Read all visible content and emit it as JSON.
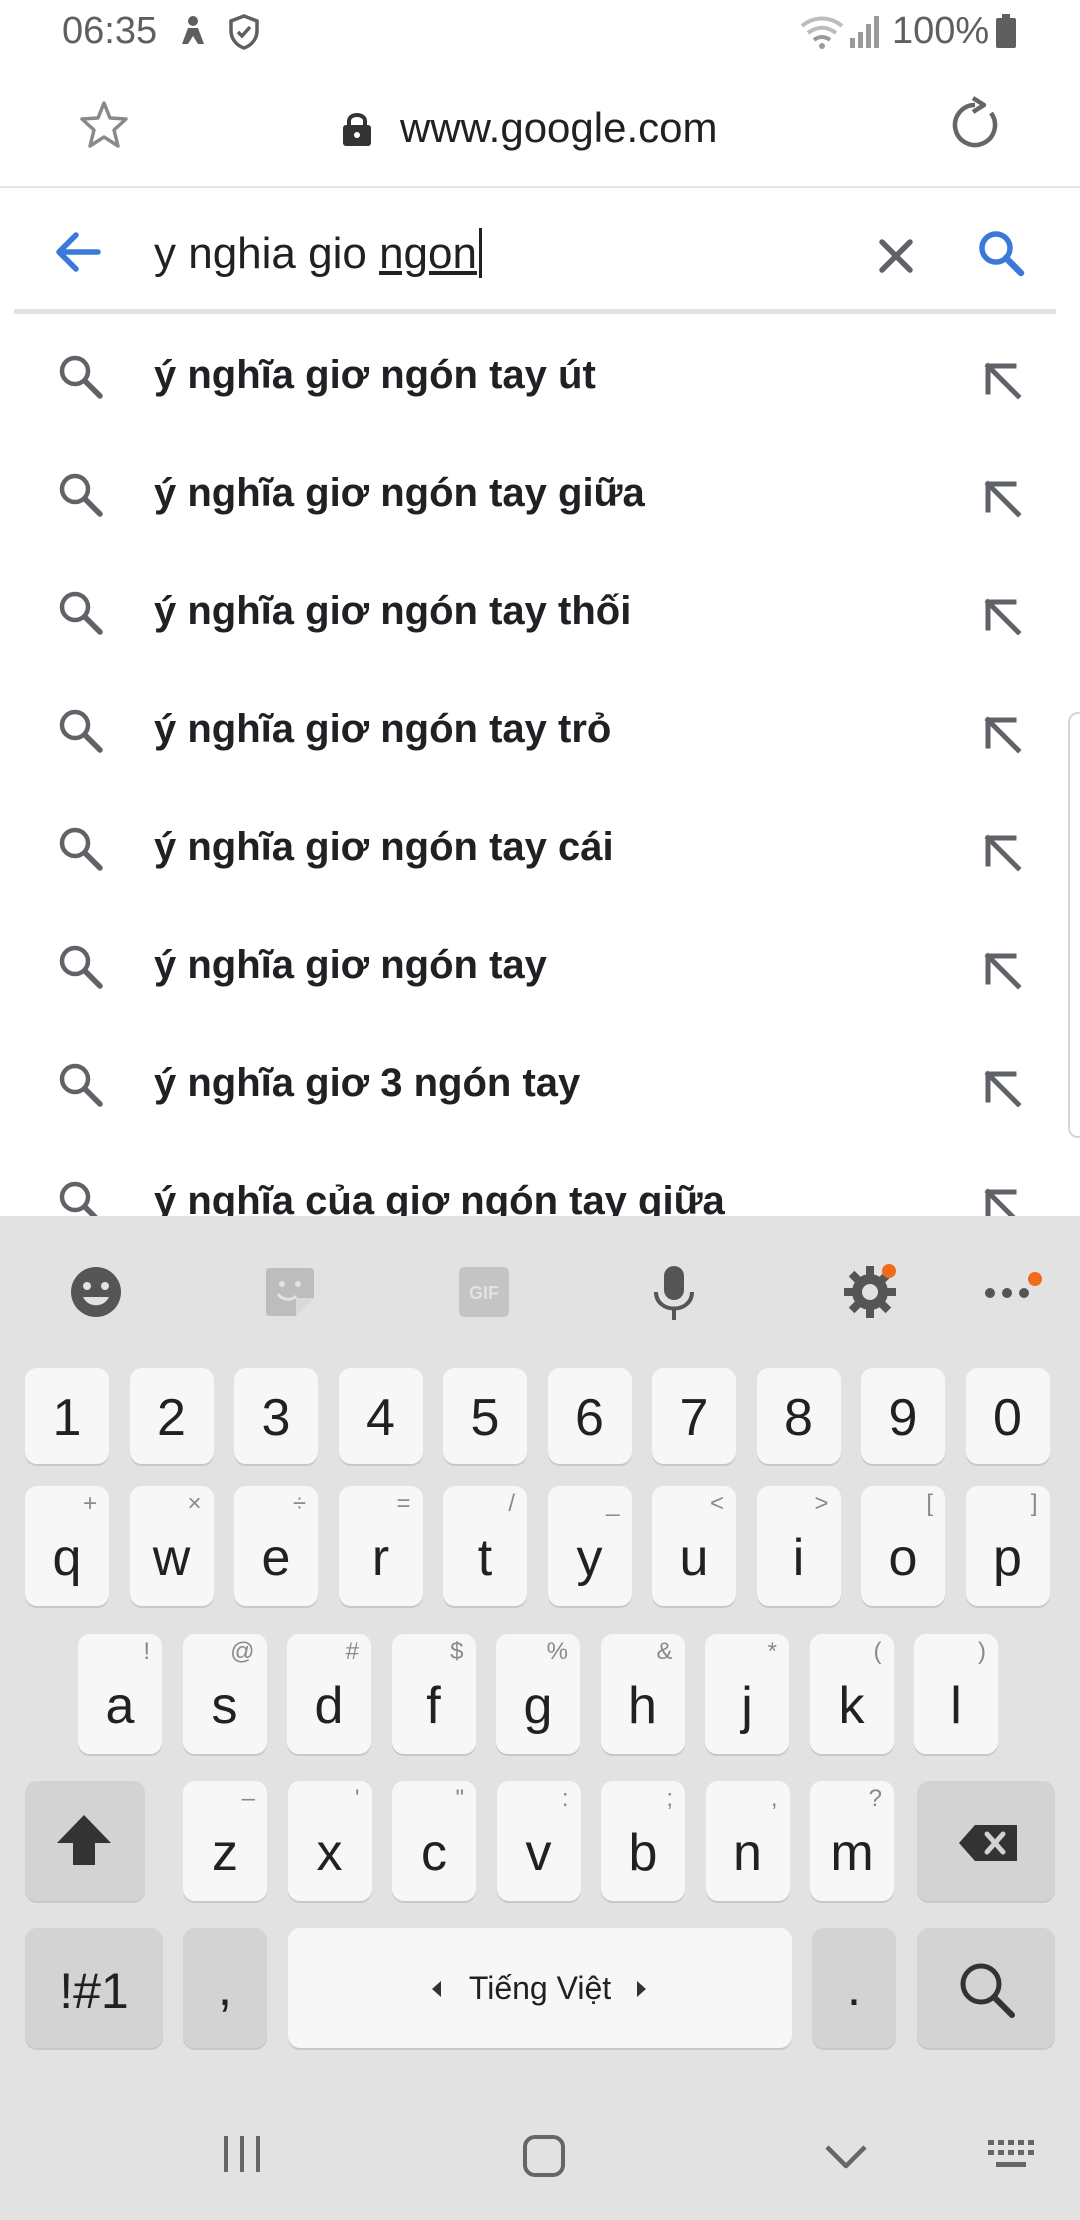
{
  "status_bar": {
    "time": "06:35",
    "battery": "100%"
  },
  "browser": {
    "url": "www.google.com"
  },
  "search": {
    "query_plain": "y nghia gio ",
    "query_underlined": "ngon"
  },
  "suggestions": [
    "ý nghĩa giơ ngón tay út",
    "ý nghĩa giơ ngón tay giữa",
    "ý nghĩa giơ ngón tay thối",
    "ý nghĩa giơ ngón tay trỏ",
    "ý nghĩa giơ ngón tay cái",
    "ý nghĩa giơ ngón tay",
    "ý nghĩa giơ 3 ngón tay",
    "ý nghĩa của giơ ngón tay giữa"
  ],
  "keyboard": {
    "numbers": [
      "1",
      "2",
      "3",
      "4",
      "5",
      "6",
      "7",
      "8",
      "9",
      "0"
    ],
    "row1": [
      {
        "k": "q",
        "h": "+"
      },
      {
        "k": "w",
        "h": "×"
      },
      {
        "k": "e",
        "h": "÷"
      },
      {
        "k": "r",
        "h": "="
      },
      {
        "k": "t",
        "h": "/"
      },
      {
        "k": "y",
        "h": "_"
      },
      {
        "k": "u",
        "h": "<"
      },
      {
        "k": "i",
        "h": ">"
      },
      {
        "k": "o",
        "h": "["
      },
      {
        "k": "p",
        "h": "]"
      }
    ],
    "row2": [
      {
        "k": "a",
        "h": "!"
      },
      {
        "k": "s",
        "h": "@"
      },
      {
        "k": "d",
        "h": "#"
      },
      {
        "k": "f",
        "h": "$"
      },
      {
        "k": "g",
        "h": "%"
      },
      {
        "k": "h",
        "h": "&"
      },
      {
        "k": "j",
        "h": "*"
      },
      {
        "k": "k",
        "h": "("
      },
      {
        "k": "l",
        "h": ")"
      }
    ],
    "row3": [
      {
        "k": "z",
        "h": "–"
      },
      {
        "k": "x",
        "h": "'"
      },
      {
        "k": "c",
        "h": "\""
      },
      {
        "k": "v",
        "h": ":"
      },
      {
        "k": "b",
        "h": ";"
      },
      {
        "k": "n",
        "h": ","
      },
      {
        "k": "m",
        "h": "?"
      }
    ],
    "symbols_label": "!#1",
    "comma": ",",
    "space_label": "Tiếng Việt",
    "period": "."
  },
  "colors": {
    "accent_blue": "#3c78d8",
    "notification_dot": "#f26b1d"
  },
  "icons": [
    "star-icon",
    "lock-icon",
    "reload-icon",
    "back-arrow-icon",
    "clear-icon",
    "search-icon",
    "fill-arrow-icon",
    "emoji-icon",
    "sticker-icon",
    "gif-icon",
    "microphone-icon",
    "settings-icon",
    "more-icon",
    "shift-icon",
    "backspace-icon",
    "recent-apps-icon",
    "home-icon",
    "hide-keyboard-icon",
    "keyboard-switch-icon"
  ]
}
